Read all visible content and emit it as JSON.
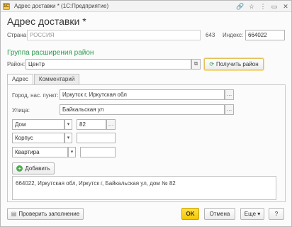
{
  "window": {
    "app_icon_text": "1C",
    "title": "Адрес доставки * (1С:Предприятие)"
  },
  "form": {
    "title": "Адрес доставки *"
  },
  "country": {
    "label": "Страна:",
    "value": "РОССИЯ",
    "code": "643"
  },
  "postal": {
    "label": "Индекс:",
    "value": "664022"
  },
  "extension_group": {
    "title": "Группа расширения район",
    "district_label": "Район:",
    "district_value": "Центр",
    "get_district_button": "Получить район"
  },
  "tabs": [
    {
      "label": "Адрес",
      "active": true
    },
    {
      "label": "Комментарий",
      "active": false
    }
  ],
  "address_fields": {
    "city_label": "Город, нас. пункт:",
    "city_value": "Иркутск г, Иркутская обл",
    "street_label": "Улица:",
    "street_value": "Байкальская ул",
    "house_type": "Дом",
    "house_value": "82",
    "building_type": "Корпус",
    "building_value": "",
    "apartment_type": "Квартира",
    "apartment_value": "",
    "add_button": "Добавить"
  },
  "full_address": "664022, Иркутская обл, Иркутск г, Байкальская ул, дом № 82",
  "footer": {
    "check_button": "Проверить заполнение",
    "ok_button": "OK",
    "cancel_button": "Отмена",
    "more_button": "Еще"
  }
}
